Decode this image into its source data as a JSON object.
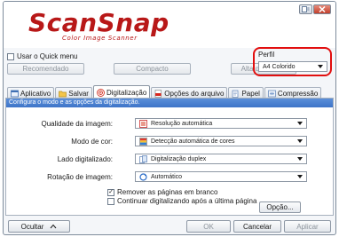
{
  "header": {
    "logo_text": "ScanSnap",
    "logo_subtitle": "Color Image Scanner",
    "help_icon": "help-icon",
    "close_icon": "close-icon"
  },
  "quick_menu": {
    "checkbox_label": "Usar o Quick menu",
    "checked": false,
    "presets": [
      "Recomendado",
      "Compacto",
      "Alta qualidade"
    ]
  },
  "perfil": {
    "label": "Perfil",
    "selected": "A4 Colorido",
    "highlight_color": "#e20f0f"
  },
  "tabs": [
    {
      "label": "Aplicativo",
      "icon": "application-icon",
      "active": false
    },
    {
      "label": "Salvar",
      "icon": "save-folder-icon",
      "active": false
    },
    {
      "label": "Digitalização",
      "icon": "scan-target-icon",
      "active": true
    },
    {
      "label": "Opções do arquivo",
      "icon": "pdf-file-icon",
      "active": false
    },
    {
      "label": "Papel",
      "icon": "paper-icon",
      "active": false
    },
    {
      "label": "Compressão",
      "icon": "compression-icon",
      "active": false
    }
  ],
  "panel": {
    "hint": "Configura o modo e as opções da digitalização.",
    "rows": [
      {
        "label": "Qualidade da imagem:",
        "value": "Resolução automática",
        "icon": "resolution-icon"
      },
      {
        "label": "Modo de cor:",
        "value": "Detecção automática de cores",
        "icon": "color-mode-icon"
      },
      {
        "label": "Lado digitalizado:",
        "value": "Digitalização duplex",
        "icon": "duplex-icon"
      },
      {
        "label": "Rotação de imagem:",
        "value": "Automático",
        "icon": "rotation-icon"
      }
    ],
    "options": [
      {
        "label": "Remover as páginas em branco",
        "checked": true
      },
      {
        "label": "Continuar digitalizando após a última página",
        "checked": false
      }
    ],
    "option_button": "Opção..."
  },
  "footer": {
    "hide_label": "Ocultar",
    "ok_label": "OK",
    "cancel_label": "Cancelar",
    "apply_label": "Aplicar"
  },
  "colors": {
    "brand": "#b81818",
    "hint_bar": "#3d74c8"
  }
}
